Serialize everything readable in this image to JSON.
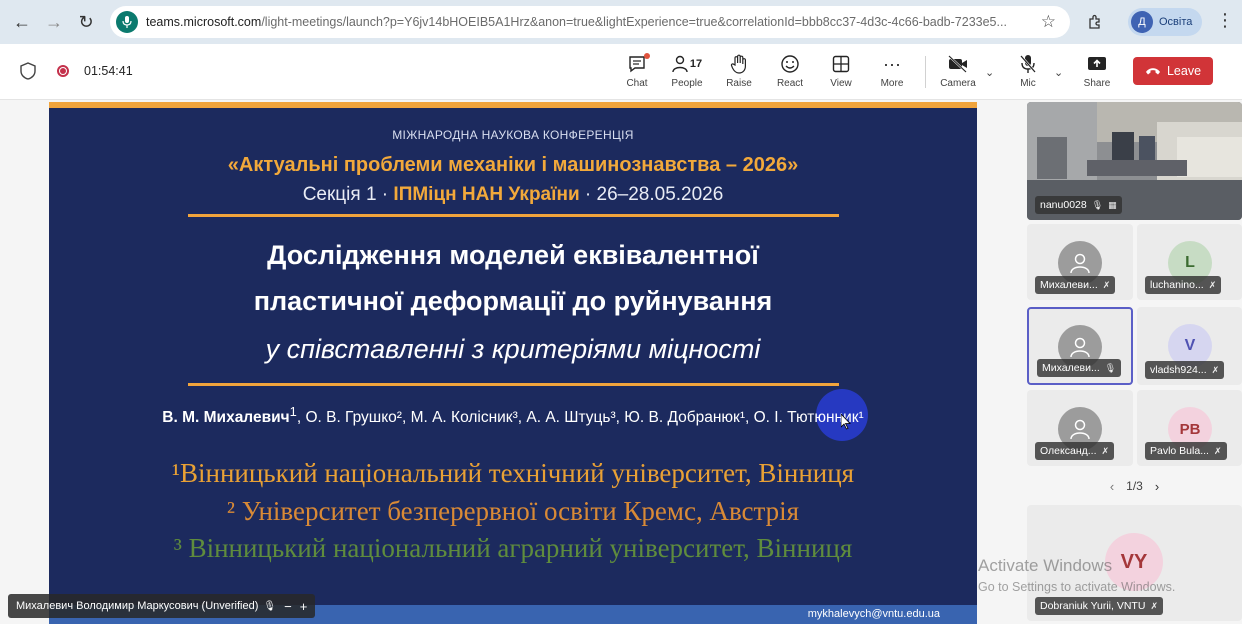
{
  "browser": {
    "url_host": "teams.microsoft.com",
    "url_rest": "/light-meetings/launch?p=Y6jv14bHOEIB5A1Hrz&anon=true&lightExperience=true&correlationId=bbb8cc37-4d3c-4c66-badb-7233e5...",
    "profile_initial": "Д",
    "profile_label": "Освіта"
  },
  "meeting": {
    "timer": "01:54:41",
    "toolbar": {
      "chat": "Chat",
      "people": "People",
      "people_count": "17",
      "raise": "Raise",
      "react": "React",
      "view": "View",
      "more": "More",
      "camera": "Camera",
      "mic": "Mic",
      "share": "Share",
      "leave": "Leave"
    }
  },
  "slide": {
    "conference_label": "МІЖНАРОДНА НАУКОВА КОНФЕРЕНЦІЯ",
    "conference_title": "«Актуальні проблеми механіки і машинознавства – 2026»",
    "section_prefix": "Секція 1 · ",
    "section_org": "ІПМіцн НАН України",
    "section_dates": " · 26–28.05.2026",
    "title_line1": "Дослідження моделей еквівалентної",
    "title_line2": "пластичної деформації до руйнування",
    "title_line3": "у співставленні з критеріями міцності",
    "author_lead": "В. М. Михалевич",
    "author_lead_sup": "1",
    "authors_rest": ", О. В. Грушко², М. А. Колісник³, А. А. Штуць³, Ю. В. Добранюк¹, О. І. Тютюнник¹",
    "affiliation1": "¹Вінницький національний технічний університет, Вінниця",
    "affiliation2": "² Університет безперервної освіти Кремс, Австрія",
    "affiliation3": "³ Вінницький національний аграрний університет, Вінниця",
    "email": "mykhalevych@vntu.edu.ua",
    "colors": {
      "background": "#1c2a5e",
      "accent": "#f2a93b",
      "bottom_bar": "#3964b0"
    }
  },
  "presenter": {
    "name": "Михалевич Володимир Маркусович (Unverified)"
  },
  "participants": {
    "video": {
      "name": "nanu0028"
    },
    "tiles": [
      {
        "name": "Михалеви...",
        "initials": "",
        "avatar_color": "#9c9c9c",
        "selected": false
      },
      {
        "name": "luchanino...",
        "initials": "L",
        "avatar_color": "#c7dcc4",
        "initials_color": "#3b6b30",
        "selected": false
      },
      {
        "name": "Михалеви...",
        "initials": "",
        "avatar_color": "#9c9c9c",
        "selected": true
      },
      {
        "name": "vladsh924...",
        "initials": "V",
        "avatar_color": "#d6d6f0",
        "initials_color": "#4f52b2",
        "selected": false
      },
      {
        "name": "Олександ...",
        "initials": "",
        "avatar_color": "#9c9c9c",
        "selected": false
      },
      {
        "name": "Pavlo Bula...",
        "initials": "PB",
        "avatar_color": "#f3d2de",
        "initials_color": "#a4373a",
        "selected": false
      }
    ],
    "pager": "1/3",
    "bottom_tile": {
      "name": "Dobraniuk Yurii, VNTU",
      "initials": "VY",
      "avatar_color": "#f3d2de",
      "initials_color": "#a4373a"
    }
  },
  "watermark": {
    "line1": "Activate Windows",
    "line2": "Go to Settings to activate Windows."
  }
}
